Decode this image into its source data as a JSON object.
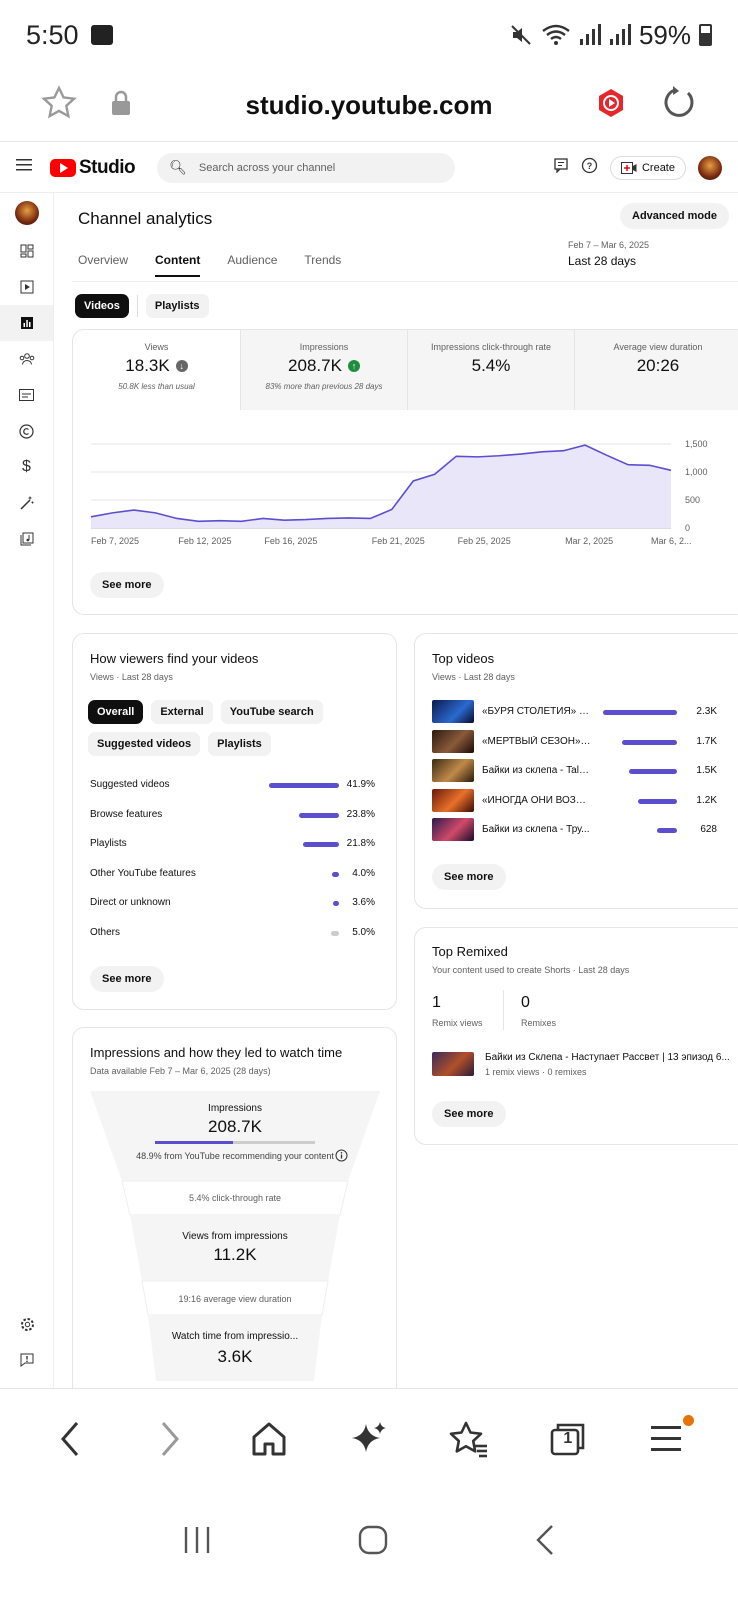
{
  "status": {
    "time": "5:50",
    "battery": "59%"
  },
  "browser": {
    "url": "studio.youtube.com"
  },
  "header": {
    "brand": "Studio",
    "search_placeholder": "Search across your channel",
    "create_label": "Create"
  },
  "page": {
    "title": "Channel analytics",
    "advanced_mode": "Advanced mode",
    "tabs": [
      "Overview",
      "Content",
      "Audience",
      "Trends"
    ],
    "active_tab": "Content",
    "date_range": "Feb 7 – Mar 6, 2025",
    "date_label": "Last 28 days",
    "chips": [
      "Videos",
      "Playlists"
    ]
  },
  "metrics": [
    {
      "label": "Views",
      "value": "18.3K",
      "sub": "50.8K less than usual"
    },
    {
      "label": "Impressions",
      "value": "208.7K",
      "sub": "83% more than previous 28 days"
    },
    {
      "label": "Impressions click-through rate",
      "value": "5.4%",
      "sub": ""
    },
    {
      "label": "Average view duration",
      "value": "20:26",
      "sub": ""
    }
  ],
  "chart_data": {
    "type": "area",
    "x": [
      "Feb 7",
      "Feb 8",
      "Feb 9",
      "Feb 10",
      "Feb 11",
      "Feb 12",
      "Feb 13",
      "Feb 14",
      "Feb 15",
      "Feb 16",
      "Feb 17",
      "Feb 18",
      "Feb 19",
      "Feb 20",
      "Feb 21",
      "Feb 22",
      "Feb 23",
      "Feb 24",
      "Feb 25",
      "Feb 26",
      "Feb 27",
      "Feb 28",
      "Mar 1",
      "Mar 2",
      "Mar 3",
      "Mar 4",
      "Mar 5",
      "Mar 6"
    ],
    "values": [
      200,
      270,
      320,
      270,
      170,
      120,
      130,
      120,
      170,
      140,
      150,
      170,
      180,
      170,
      330,
      840,
      960,
      1280,
      1270,
      1290,
      1320,
      1360,
      1380,
      1480,
      1300,
      1130,
      1120,
      1030
    ],
    "x_tick_labels": [
      "Feb 7, 2025",
      "Feb 12, 2025",
      "Feb 16, 2025",
      "Feb 21, 2025",
      "Feb 25, 2025",
      "Mar 2, 2025",
      "Mar 6, 2..."
    ],
    "y_tick_labels": [
      "1,500",
      "1,000",
      "500",
      "0"
    ],
    "ylim": [
      0,
      1500
    ]
  },
  "see_more": "See more",
  "traffic": {
    "title": "How viewers find your videos",
    "sub": "Views · Last 28 days",
    "chips": [
      "Overall",
      "External",
      "YouTube search",
      "Suggested videos",
      "Playlists"
    ],
    "rows": [
      {
        "label": "Suggested videos",
        "value": "41.9%",
        "pct": 41.9
      },
      {
        "label": "Browse features",
        "value": "23.8%",
        "pct": 23.8
      },
      {
        "label": "Playlists",
        "value": "21.8%",
        "pct": 21.8
      },
      {
        "label": "Other YouTube features",
        "value": "4.0%",
        "pct": 4.0
      },
      {
        "label": "Direct or unknown",
        "value": "3.6%",
        "pct": 3.6
      },
      {
        "label": "Others",
        "value": "5.0%",
        "pct": 5.0
      }
    ]
  },
  "top_videos": {
    "title": "Top videos",
    "sub": "Views · Last 28 days",
    "rows": [
      {
        "title": "«БУРЯ СТОЛЕТИЯ» ( С...",
        "value": "2.3K",
        "num": 2300
      },
      {
        "title": "«МЕРТВЫЙ СЕЗОН» — ...",
        "value": "1.7K",
        "num": 1700
      },
      {
        "title": "Байки из склепа - Tale...",
        "value": "1.5K",
        "num": 1500
      },
      {
        "title": "«ИНОГДА ОНИ ВОЗВР...",
        "value": "1.2K",
        "num": 1200
      },
      {
        "title": "Байки из склепа - Тру...",
        "value": "628",
        "num": 628
      }
    ]
  },
  "remixed": {
    "title": "Top Remixed",
    "sub": "Your content used to create Shorts · Last 28 days",
    "remix_views": "1",
    "remix_views_label": "Remix views",
    "remixes": "0",
    "remixes_label": "Remixes",
    "item_title": "Байки из Склепа - Наступает Рассвет | 13 эпизод 6...",
    "item_sub": "1 remix views · 0 remixes"
  },
  "funnel": {
    "title": "Impressions and how they led to watch time",
    "sub": "Data available Feb 7 – Mar 6, 2025 (28 days)",
    "impressions_label": "Impressions",
    "impressions_value": "208.7K",
    "recommend_pct": 48.9,
    "recommend_text": "48.9% from YouTube recommending your content",
    "ctr_text": "5.4% click-through rate",
    "views_label": "Views from impressions",
    "views_value": "11.2K",
    "avd_text": "19:16 average view duration",
    "watch_label": "Watch time from impressio...",
    "watch_value": "3.6K"
  },
  "bottom_nav": {
    "tabs_count": "1"
  },
  "colors": {
    "accent": "#5b4fd0",
    "yt_red": "#ff0000",
    "badge": "#e8710a"
  }
}
